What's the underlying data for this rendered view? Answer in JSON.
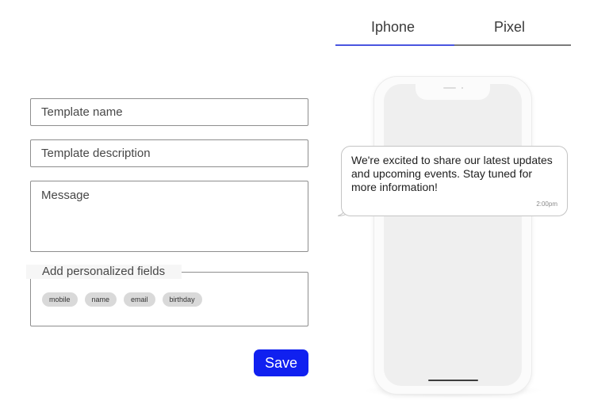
{
  "tabs": [
    {
      "label": "Iphone",
      "active": true
    },
    {
      "label": "Pixel",
      "active": false
    }
  ],
  "form": {
    "template_name": {
      "placeholder": "Template name",
      "value": ""
    },
    "template_description": {
      "placeholder": "Template description",
      "value": ""
    },
    "message": {
      "placeholder": "Message",
      "value": ""
    },
    "personalized_fields": {
      "legend": "Add personalized fields",
      "chips": [
        "mobile",
        "name",
        "email",
        "birthday"
      ]
    },
    "save_label": "Save"
  },
  "preview": {
    "message_text": "We're excited to share our latest updates and upcoming events. Stay tuned for more information!",
    "timestamp": "2:00pm"
  },
  "colors": {
    "accent": "#1020f0",
    "tab_active": "#4a56e0"
  }
}
